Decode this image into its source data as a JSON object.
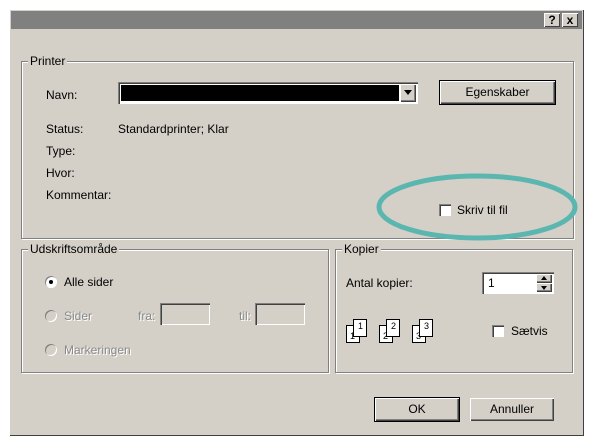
{
  "title_buttons": {
    "help": "?",
    "close": "x"
  },
  "printer": {
    "legend": "Printer",
    "name_label": "Navn:",
    "name_value": "",
    "properties_button": "Egenskaber",
    "status_label": "Status:",
    "status_value": "Standardprinter; Klar",
    "type_label": "Type:",
    "where_label": "Hvor:",
    "comment_label": "Kommentar:",
    "print_to_file_label": "Skriv til fil",
    "print_to_file_checked": false
  },
  "print_range": {
    "legend": "Udskriftsområde",
    "all_pages_label": "Alle sider",
    "all_pages_selected": true,
    "pages_label": "Sider",
    "from_label": "fra:",
    "to_label": "til:",
    "selection_label": "Markeringen"
  },
  "copies": {
    "legend": "Kopier",
    "count_label": "Antal kopier:",
    "count_value": "1",
    "collate_label": "Sætvis",
    "collate_checked": false,
    "pages": [
      "1",
      "1",
      "2",
      "2",
      "3",
      "3"
    ]
  },
  "buttons": {
    "ok": "OK",
    "cancel": "Annuller"
  },
  "annotation": {
    "highlight_color": "#5bb6b0"
  }
}
